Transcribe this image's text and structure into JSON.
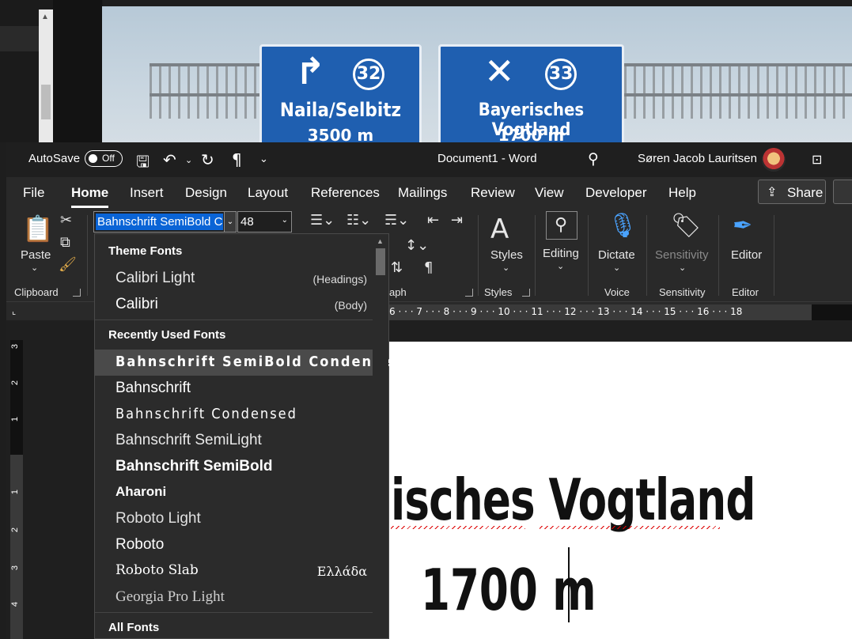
{
  "background_photo": {
    "sign_left": {
      "exit": "32",
      "place": "Naila/Selbitz",
      "distance": "3500 m"
    },
    "sign_right": {
      "exit": "33",
      "place": "Bayerisches Vogtland",
      "distance": "1700 m"
    }
  },
  "titlebar": {
    "autosave_label": "AutoSave",
    "autosave_state": "Off",
    "document_title": "Document1  -  Word",
    "user_name": "Søren Jacob Lauritsen"
  },
  "menu_tabs": [
    "File",
    "Home",
    "Insert",
    "Design",
    "Layout",
    "References",
    "Mailings",
    "Review",
    "View",
    "Developer",
    "Help"
  ],
  "share_label": "Share",
  "ribbon": {
    "paste_label": "Paste",
    "clipboard_label": "Clipboard",
    "font_name": "Bahnschrift SemiBold Condensed",
    "font_size": "48",
    "paragraph_label": "aph",
    "styles_button": "Styles",
    "styles_group": "Styles",
    "editing_button": "Editing",
    "dictate_button": "Dictate",
    "voice_group": "Voice",
    "sensitivity_button": "Sensitivity",
    "sensitivity_group": "Sensitivity",
    "editor_button": "Editor",
    "editor_group": "Editor"
  },
  "ruler": {
    "horizontal": "6 · · · 7 · · · 8 · · · 9 · · · 10 · · · 11 · · · 12 · · · 13 · · · 14 · · · 15 · · · 16 · · · 18",
    "vertical": [
      "3",
      "2",
      "1",
      "1",
      "2",
      "3",
      "4"
    ]
  },
  "font_dropdown": {
    "theme_header": "Theme Fonts",
    "theme_fonts": [
      {
        "name": "Calibri Light",
        "tag": "(Headings)"
      },
      {
        "name": "Calibri",
        "tag": "(Body)"
      }
    ],
    "recent_header": "Recently Used Fonts",
    "recent_fonts": [
      {
        "name": "Bahnschrift SemiBold Condensed",
        "tag": ""
      },
      {
        "name": "Bahnschrift",
        "tag": ""
      },
      {
        "name": "Bahnschrift Condensed",
        "tag": ""
      },
      {
        "name": "Bahnschrift SemiLight",
        "tag": ""
      },
      {
        "name": "Bahnschrift SemiBold",
        "tag": ""
      },
      {
        "name": "Aharoni",
        "tag": ""
      },
      {
        "name": "Roboto Light",
        "tag": ""
      },
      {
        "name": "Roboto",
        "tag": ""
      },
      {
        "name": "Roboto Slab",
        "tag": "Ελλάδα"
      },
      {
        "name": "Georgia Pro Light",
        "tag": ""
      }
    ],
    "all_header": "All Fonts"
  },
  "document": {
    "line1": "isches Vogtland",
    "line2": "1700 m"
  }
}
